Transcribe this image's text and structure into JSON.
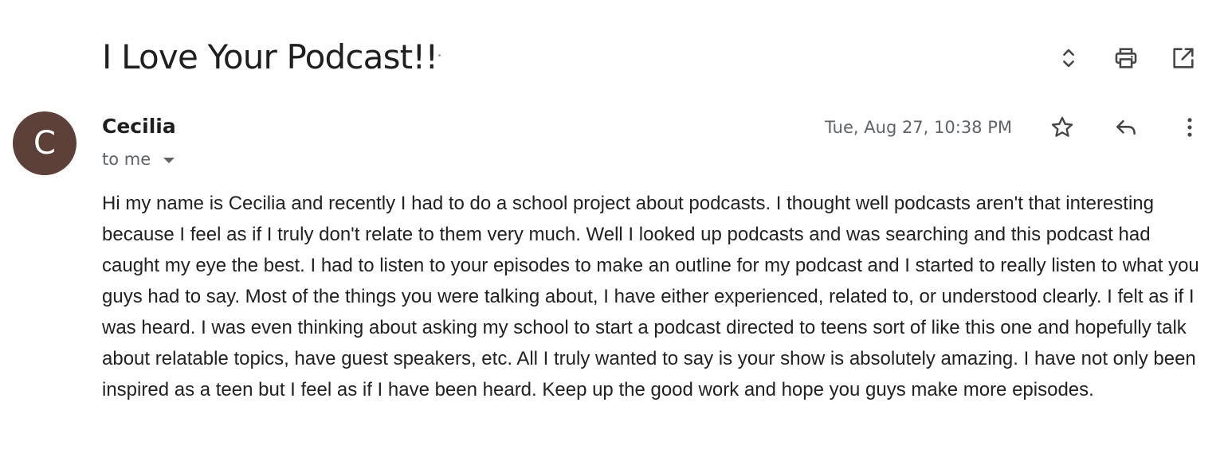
{
  "email": {
    "subject": "I Love Your Podcast!!",
    "sender": {
      "initial": "C",
      "name": "Cecilia",
      "recipient_label": "to me",
      "avatar_color": "#5d4037"
    },
    "timestamp": "Tue, Aug 27, 10:38 PM",
    "body": "Hi my name is Cecilia and recently I had to do a school project about podcasts. I thought well podcasts aren't that interesting because I feel as if I truly don't relate to them very much. Well I looked up podcasts and was searching and this podcast had caught my eye the best. I had to listen to your episodes to make an outline for my podcast and I started to really listen to what you guys had to say. Most of the things you were talking about, I have either experienced, related to, or understood clearly. I felt as if I was heard. I was even thinking about asking my school to start a podcast directed to teens sort of like this one and hopefully talk about relatable topics, have guest speakers, etc. All I truly wanted to say is your show is absolutely amazing. I have not only been inspired as a teen but I feel as if I have been heard. Keep up the good work and hope you guys make more episodes."
  },
  "icons": {
    "top_actions": [
      "expand-collapse-icon",
      "print-icon",
      "open-in-new-window-icon"
    ],
    "message_actions": [
      "star-icon",
      "reply-icon",
      "more-options-icon"
    ]
  },
  "colors": {
    "text_primary": "#1f1f1f",
    "text_secondary": "#5f6368",
    "icon": "#444746"
  }
}
